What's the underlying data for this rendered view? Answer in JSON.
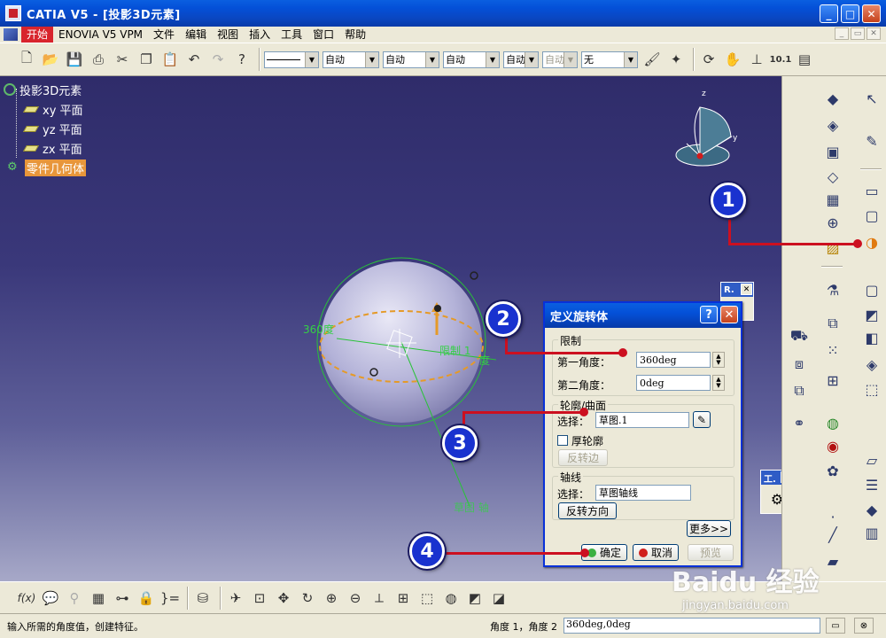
{
  "window": {
    "title": "CATIA V5 - [投影3D元素]"
  },
  "menu": [
    "开始",
    "ENOVIA V5 VPM",
    "文件",
    "编辑",
    "视图",
    "插入",
    "工具",
    "窗口",
    "帮助"
  ],
  "toolbar": {
    "selects": [
      {
        "value": "",
        "disabled": false
      },
      {
        "value": "自动",
        "disabled": false
      },
      {
        "value": "自动",
        "disabled": false
      },
      {
        "value": "自动",
        "disabled": false
      },
      {
        "value": "自动",
        "disabled": false
      },
      {
        "value": "自动",
        "disabled": true
      },
      {
        "value": "无",
        "disabled": false
      }
    ]
  },
  "tree": {
    "root": "投影3D元素",
    "children": [
      "xy 平面",
      "yz 平面",
      "zx 平面"
    ],
    "body": "零件几何体"
  },
  "viewport": {
    "angle_label": "360度",
    "limit_label": "限制 1",
    "degree_label": "度",
    "axis_label": "草图 轴"
  },
  "floating": {
    "r_title": "R.",
    "tool_title": "工."
  },
  "dialog": {
    "title": "定义旋转体",
    "help": "?",
    "limits": {
      "label": "限制",
      "first_label": "第一角度：",
      "first_value": "360deg",
      "second_label": "第二角度：",
      "second_value": "0deg"
    },
    "profile": {
      "label": "轮廓/曲面",
      "select_label": "选择：",
      "select_value": "草图.1",
      "thick_label": "厚轮廓",
      "reverse_side": "反转边"
    },
    "axis": {
      "label": "轴线",
      "select_label": "选择：",
      "select_value": "草图轴线",
      "reverse_dir": "反转方向"
    },
    "more": "更多>>",
    "ok": "确定",
    "cancel": "取消",
    "preview": "预览"
  },
  "status": {
    "message": "输入所需的角度值，创建特征。",
    "param_label": "角度 1，角度 2",
    "param_value": "360deg,0deg"
  },
  "callouts": [
    "1",
    "2",
    "3",
    "4"
  ],
  "watermark": {
    "brand": "Baidu 经验",
    "url": "jingyan.baidu.com"
  },
  "colors": {
    "callout": "#1932cf",
    "leader": "#cc1020",
    "xp_blue": "#0a5fe0",
    "tree_highlight": "#e8963a"
  }
}
